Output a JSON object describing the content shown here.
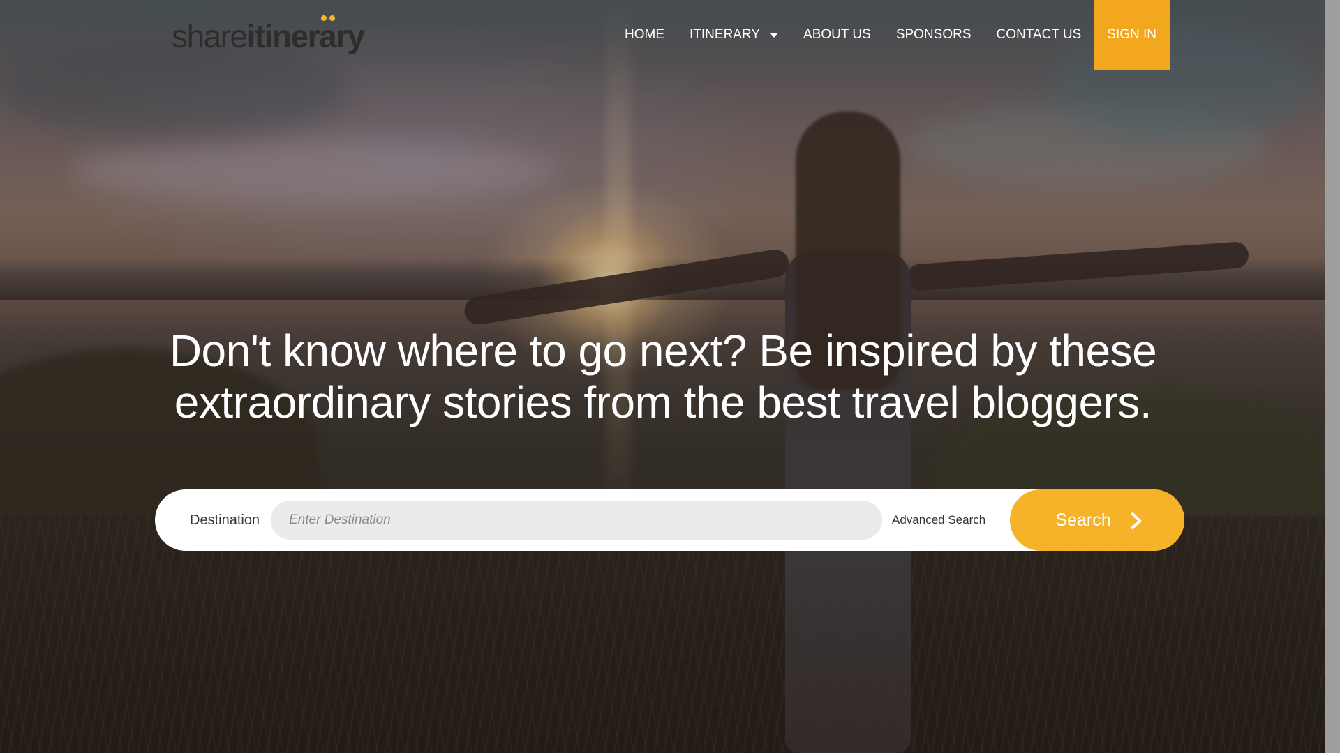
{
  "brand": {
    "logo_part1": "share",
    "logo_part2": "itinerary",
    "accent_color": "#f6b228",
    "signin_bg": "#f2a71e"
  },
  "nav": {
    "items": [
      {
        "label": "HOME"
      },
      {
        "label": "ITINERARY",
        "icon": "caret-down-icon"
      },
      {
        "label": "ABOUT US"
      },
      {
        "label": "SPONSORS"
      },
      {
        "label": "CONTACT US"
      }
    ],
    "signin_label": "SIGN IN"
  },
  "hero": {
    "headline": "Don't know where to go next? Be inspired by these extraordinary stories from the best travel bloggers."
  },
  "search": {
    "destination_label": "Destination",
    "destination_placeholder": "Enter Destination",
    "advanced_label": "Advanced Search",
    "button_label": "Search",
    "button_icon": "chevron-right-icon"
  }
}
